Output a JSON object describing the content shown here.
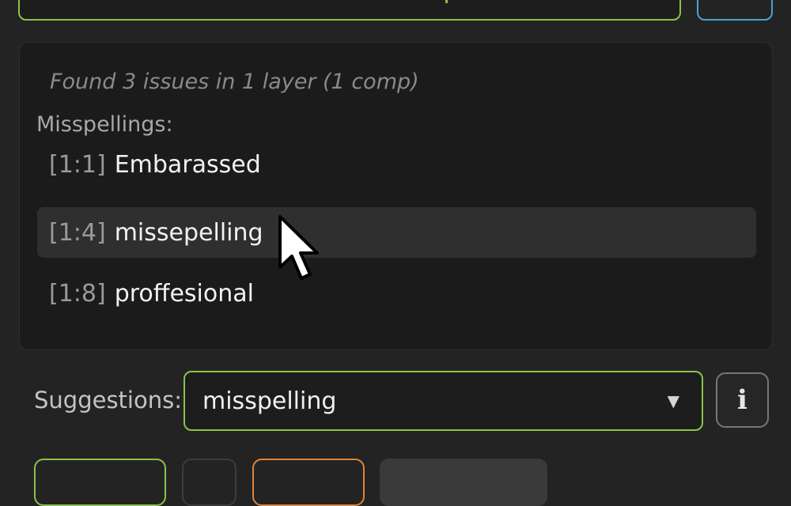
{
  "results": {
    "summary": "Found 3 issues in 1 layer (1 comp)",
    "misspellings_label": "Misspellings:",
    "issues": [
      {
        "location": "[1:1]",
        "word": "Embarassed",
        "selected": false
      },
      {
        "location": "[1:4]",
        "word": "missepelling",
        "selected": true
      },
      {
        "location": "[1:8]",
        "word": "proffesional",
        "selected": false
      }
    ]
  },
  "suggestions": {
    "label": "Suggestions:",
    "selected_value": "misspelling",
    "arrow": "▼"
  },
  "info_button": {
    "icon": "info-icon",
    "glyph": "i"
  },
  "colors": {
    "background": "#232323",
    "panel": "#1b1b1b",
    "accent_green": "#8bc34a",
    "accent_blue": "#4a9fd6",
    "accent_orange": "#e0843a",
    "selected_row": "#2f2f2f"
  },
  "cursor": {
    "icon": "mouse-pointer-icon"
  }
}
